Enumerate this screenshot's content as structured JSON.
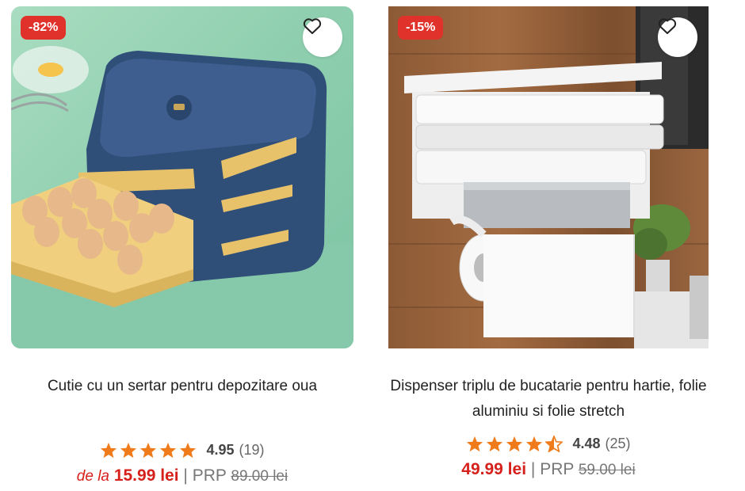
{
  "products": [
    {
      "discount": "-82%",
      "title": "Cutie cu un sertar pentru depozitare oua",
      "rating": "4.95",
      "reviews": "(19)",
      "price_prefix": "de la",
      "price": "15.99 lei",
      "separator": "|",
      "prp_label": "PRP",
      "old_price": "89.00 lei",
      "stars": [
        "full",
        "full",
        "full",
        "full",
        "full"
      ]
    },
    {
      "discount": "-15%",
      "title": "Dispenser triplu de bucatarie pentru hartie, folie aluminiu si folie stretch",
      "rating": "4.48",
      "reviews": "(25)",
      "price_prefix": "",
      "price": "49.99 lei",
      "separator": "|",
      "prp_label": "PRP",
      "old_price": "59.00 lei",
      "stars": [
        "full",
        "full",
        "full",
        "full",
        "half"
      ]
    }
  ],
  "colors": {
    "discount_badge": "#e0312a",
    "price": "#d6201b",
    "star": "#f07b1a"
  },
  "icons": [
    "heart-outline-icon",
    "star-icon",
    "star-half-icon"
  ]
}
